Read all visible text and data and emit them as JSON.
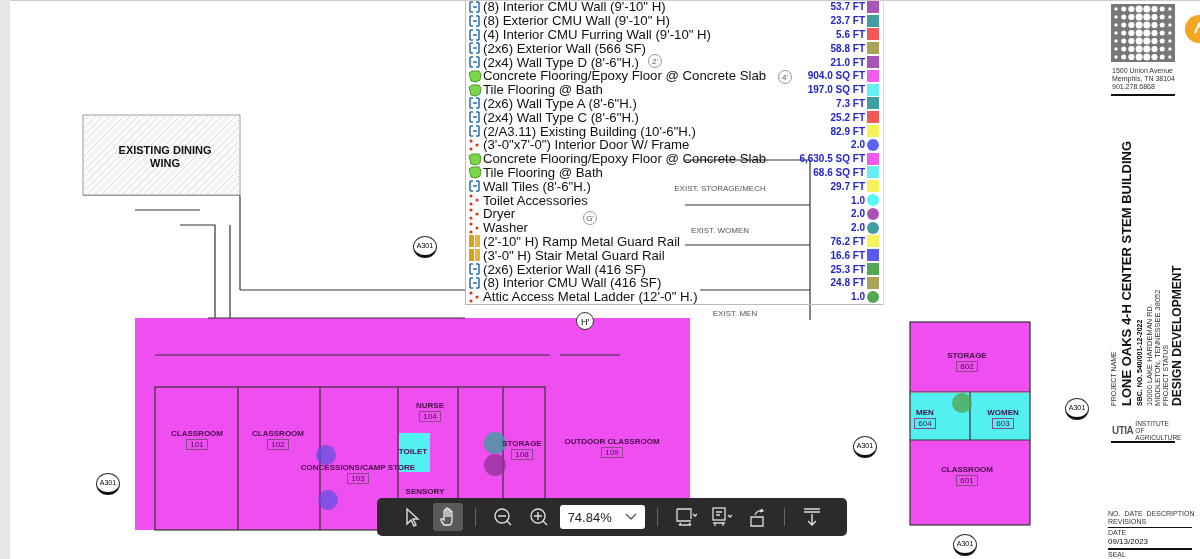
{
  "takeoff_legend": {
    "rows": [
      {
        "kind": "wall",
        "label": "(8) Interior CMU Wall (9'-10\" H)",
        "quantity": "53.7 FT",
        "color": "#a855b5"
      },
      {
        "kind": "wall",
        "label": "(8) Exterior CMU Wall (9'-10\" H)",
        "quantity": "23.7 FT",
        "color": "#3f9e9e"
      },
      {
        "kind": "wall",
        "label": "(4) Interior CMU Furring Wall (9'-10\" H)",
        "quantity": "5.6 FT",
        "color": "#f25a5a"
      },
      {
        "kind": "wall",
        "label": "(2x6) Exterior Wall (566 SF)",
        "quantity": "58.8 FT",
        "color": "#a9a35a"
      },
      {
        "kind": "wall",
        "label": "(2x4) Wall Type D (8'-6\"H.)",
        "quantity": "21.0 FT",
        "color": "#a855b5"
      },
      {
        "kind": "area",
        "label": "Concrete Flooring/Epoxy Floor @ Concrete Slab",
        "quantity": "904.0 SQ FT",
        "color": "#f55af0"
      },
      {
        "kind": "area",
        "label": "Tile Flooring @ Bath",
        "quantity": "197.0 SQ FT",
        "color": "#66eef5"
      },
      {
        "kind": "wall",
        "label": "(2x6) Wall Type A (8'-6\"H.)",
        "quantity": "7.3 FT",
        "color": "#3f9e9e"
      },
      {
        "kind": "wall",
        "label": "(2x4) Wall Type C (8'-6\"H.)",
        "quantity": "25.2 FT",
        "color": "#f25a5a"
      },
      {
        "kind": "wall",
        "label": "(2/A3.11) Existing Building (10'-6\"H.)",
        "quantity": "82.9 FT",
        "color": "#f5f25a"
      },
      {
        "kind": "count",
        "label": "(3'-0\"x7'-0\") Interior Door W/ Frame",
        "quantity": "2.0",
        "color": "#5a64f0"
      },
      {
        "kind": "area",
        "label": "Concrete Flooring/Epoxy Floor @ Concrete Slab",
        "quantity": "6,630.5 SQ FT",
        "color": "#f55af0"
      },
      {
        "kind": "area",
        "label": "Tile Flooring @ Bath",
        "quantity": "68.6 SQ FT",
        "color": "#66eef5"
      },
      {
        "kind": "wall",
        "label": "Wall Tiles (8'-6\"H.)",
        "quantity": "29.7 FT",
        "color": "#f5f25a"
      },
      {
        "kind": "count",
        "label": "Toilet Accessories",
        "quantity": "1.0",
        "color": "#5af5f5"
      },
      {
        "kind": "count",
        "label": "Dryer",
        "quantity": "2.0",
        "color": "#a855b5"
      },
      {
        "kind": "count",
        "label": "Washer",
        "quantity": "2.0",
        "color": "#3f9e9e"
      },
      {
        "kind": "rail",
        "label": "(2'-10\" H) Ramp Metal Guard Rail",
        "quantity": "76.2 FT",
        "color": "#f5f25a"
      },
      {
        "kind": "rail",
        "label": "(3'-0\" H) Stair Metal Guard Rail",
        "quantity": "16.6 FT",
        "color": "#5a5af0"
      },
      {
        "kind": "wall",
        "label": "(2x6) Exterior Wall (416 SF)",
        "quantity": "25.3 FT",
        "color": "#52a852"
      },
      {
        "kind": "wall",
        "label": "(8) Interior CMU Wall (416 SF)",
        "quantity": "24.8 FT",
        "color": "#a9a35a"
      },
      {
        "kind": "count",
        "label": "Attic Access Metal Ladder (12'-0\" H.)",
        "quantity": "1.0",
        "color": "#52a852"
      }
    ]
  },
  "drawing": {
    "existing_wing": "EXISTING DINING WING",
    "rooms": [
      {
        "name": "CLASSROOM",
        "number": "101"
      },
      {
        "name": "CLASSROOM",
        "number": "102"
      },
      {
        "name": "CONCESSIONS/CAMP STORE",
        "number": "103"
      },
      {
        "name": "NURSE",
        "number": "104"
      },
      {
        "name": "TOILET"
      },
      {
        "name": "SENSORY"
      },
      {
        "name": "STORAGE",
        "number": "108"
      },
      {
        "name": "OUTDOOR CLASSROOM",
        "number": "109"
      },
      {
        "name": "STORAGE",
        "number": "602"
      },
      {
        "name": "MEN",
        "number": "604"
      },
      {
        "name": "WOMEN",
        "number": "603"
      },
      {
        "name": "CLASSROOM",
        "number": "601"
      },
      {
        "name": "EXIST. STORAGE/MECH"
      },
      {
        "name": "EXIST. WOMEN"
      },
      {
        "name": "EXIST. MEN"
      }
    ],
    "grid_bubbles": [
      "H'",
      "G'",
      "4'",
      "2'"
    ],
    "section_markers": [
      "A301",
      "A301",
      "A301",
      "A301",
      "A301"
    ]
  },
  "title_block": {
    "address": [
      "1500 Union Avenue",
      "Memphis, TN 38104",
      "901.278.6868"
    ],
    "project_label": "PROJECT NAME",
    "project_name": "LONE OAKS 4-H CENTER STEM BUILDING",
    "project_number": "SBC. NO. 540/001-12-2022",
    "site_address": [
      "10000 LAKE HARDEMAN RD.",
      "MIDDLETON, TENNESSEE 38052"
    ],
    "status_label": "PROJECT STATUS",
    "status": "DESIGN DEVELOPMENT",
    "institute_mark": "UTIA",
    "institute_name": "INSTITUTE OF AGRICULTURE",
    "revision_columns": [
      "NO.",
      "DATE",
      "DESCRIPTION"
    ],
    "revisions_label": "REVISIONS",
    "date_label": "DATE",
    "date": "09/13/2023",
    "seal_label": "SEAL"
  },
  "toolbar": {
    "tools": [
      {
        "kind": "select",
        "selected": false
      },
      {
        "kind": "hand",
        "selected": true
      }
    ],
    "zoom": "74.84%"
  }
}
